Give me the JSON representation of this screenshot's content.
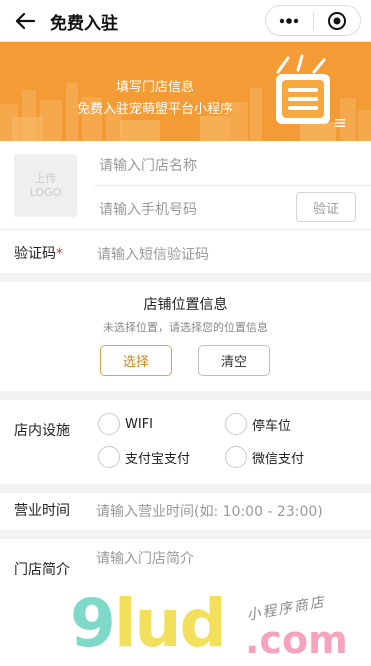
{
  "header": {
    "title": "免费入驻"
  },
  "banner": {
    "line1": "填写门店信息",
    "line2": "免费入驻宠萌盟平台小程序"
  },
  "store": {
    "logo_line1": "上传",
    "logo_line2": "LOGO",
    "name_placeholder": "请输入门店名称",
    "phone_placeholder": "请输入手机号码",
    "code_button": "验证"
  },
  "verify": {
    "label": "验证码",
    "required_mark": "*",
    "placeholder": "请输入短信验证码"
  },
  "location": {
    "title": "店铺位置信息",
    "subtitle": "未选择位置，请选择您的位置信息",
    "select_button": "选择",
    "clear_button": "清空"
  },
  "facilities": {
    "label": "店内设施",
    "options": [
      "WIFI",
      "停车位",
      "支付宝支付",
      "微信支付"
    ]
  },
  "hours": {
    "label": "营业时间",
    "placeholder": "请输入营业时间(如: 10:00 - 23:00)"
  },
  "intro": {
    "label": "门店简介",
    "placeholder": "请输入门店简介"
  },
  "watermark": {
    "main_a": "9",
    "main_b": "lud",
    "com": ".com",
    "shop": "小程序商店"
  },
  "colors": {
    "banner": "#f39b34",
    "accent": "#c68a1e",
    "required": "#e8342c"
  }
}
